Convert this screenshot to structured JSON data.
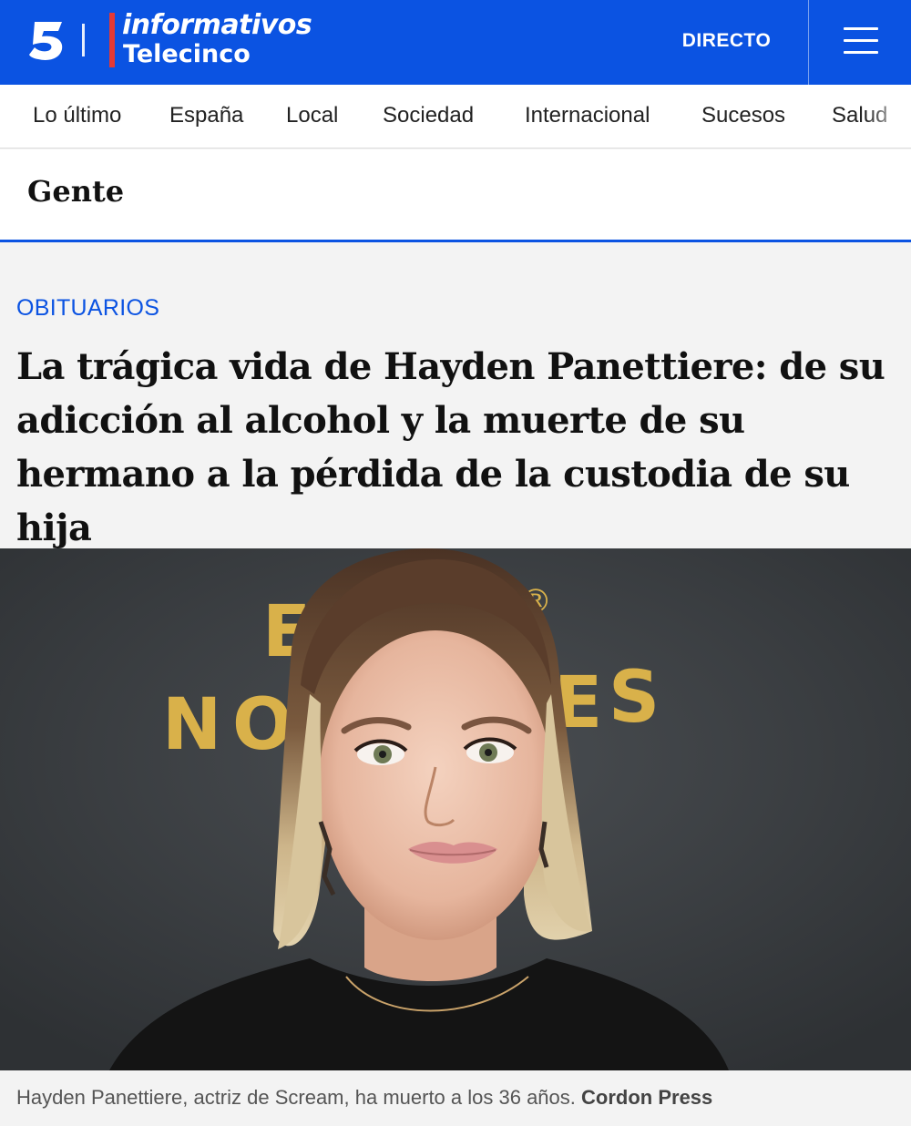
{
  "header": {
    "brand_top": "informativos",
    "brand_bottom": "Telecinco",
    "live_label": "DIRECTO",
    "accent_color": "#0b53e2",
    "logo_icon": "channel-5-icon",
    "menu_icon": "hamburger-menu-icon"
  },
  "nav": {
    "items": [
      "Lo último",
      "España",
      "Local",
      "Sociedad",
      "Internacional",
      "Sucesos",
      "Salud"
    ]
  },
  "section": {
    "title": "Gente"
  },
  "article": {
    "kicker": "OBITUARIOS",
    "headline": "La trágica vida de Hayden Panettiere: de su adicción al alcohol y la muerte de su hermano a la pérdida de la custodia de su hija",
    "photo": {
      "backdrop_letters": [
        "E",
        "N",
        "O",
        "E",
        "S",
        "®"
      ]
    },
    "caption": "Hayden Panettiere, actriz de Scream, ha muerto a los 36 años.",
    "credit": "Cordon Press"
  }
}
